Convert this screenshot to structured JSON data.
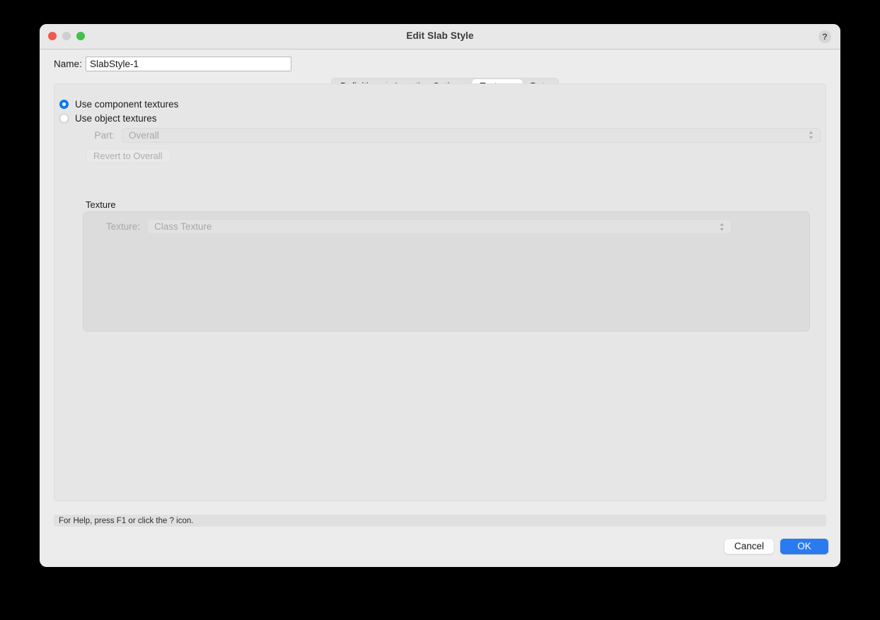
{
  "window": {
    "title": "Edit Slab Style",
    "help_icon": "?",
    "traffic_lights": [
      {
        "name": "close",
        "color": "#f1584d"
      },
      {
        "name": "minimize",
        "color": "#cfcfcf"
      },
      {
        "name": "zoom",
        "color": "#3fc14b"
      }
    ]
  },
  "name_field": {
    "label": "Name:",
    "value": "SlabStyle-1",
    "placeholder": "Name"
  },
  "tabs": [
    {
      "label": "Definition",
      "active": false
    },
    {
      "label": "Insertion Options",
      "active": false
    },
    {
      "label": "Textures",
      "active": true
    },
    {
      "label": "Data",
      "active": false
    }
  ],
  "textures_panel": {
    "radios": [
      {
        "label": "Use component textures",
        "selected": true
      },
      {
        "label": "Use object textures",
        "selected": false
      }
    ],
    "part": {
      "label": "Part:",
      "value": "Overall",
      "enabled": false
    },
    "revert_button": {
      "label": "Revert to Overall",
      "enabled": false
    },
    "texture_group": {
      "label": "Texture",
      "texture": {
        "label": "Texture:",
        "value": "Class Texture",
        "enabled": false
      }
    }
  },
  "status_bar": {
    "text": "For Help, press F1 or click the ? icon."
  },
  "footer": {
    "cancel_label": "Cancel",
    "ok_label": "OK"
  },
  "colors": {
    "accent": "#2a7bf0",
    "radio_selected": "#0a7bf7",
    "window_bg": "#ececec",
    "panel_bg": "#e6e6e6",
    "group_bg": "#dcdcdc"
  }
}
